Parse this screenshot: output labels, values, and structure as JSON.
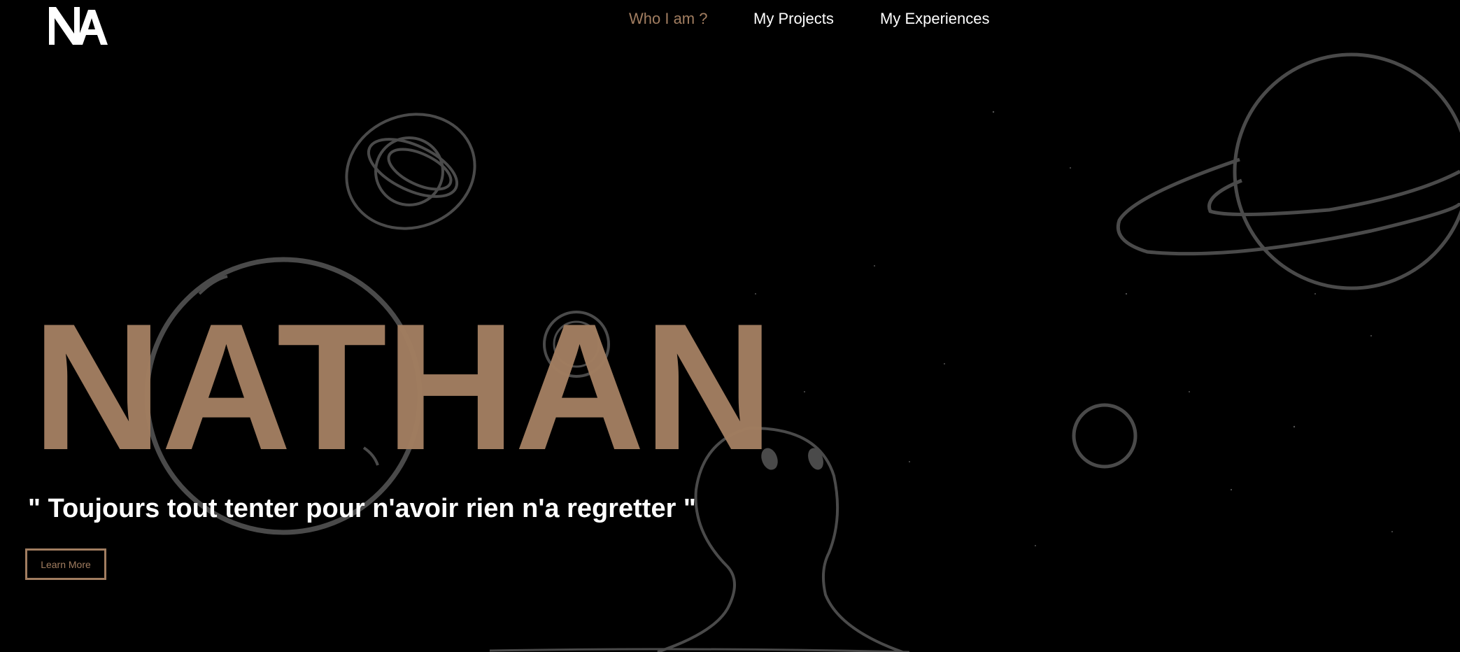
{
  "logo": {
    "text": "NA"
  },
  "nav": {
    "items": [
      {
        "label": "Who I am ?",
        "active": true
      },
      {
        "label": "My Projects",
        "active": false
      },
      {
        "label": "My Experiences",
        "active": false
      }
    ]
  },
  "hero": {
    "name": "NATHAN",
    "quote": "\" Toujours tout tenter pour n'avoir rien n'a regretter \"",
    "cta_label": "Learn More"
  },
  "colors": {
    "background": "#000000",
    "accent": "#a17d60",
    "text": "#ffffff",
    "line_art": "#4a4a4a"
  },
  "icons": [
    "planet-icon",
    "ringed-planet-icon",
    "moon-icon",
    "astronaut-icon",
    "stars"
  ]
}
